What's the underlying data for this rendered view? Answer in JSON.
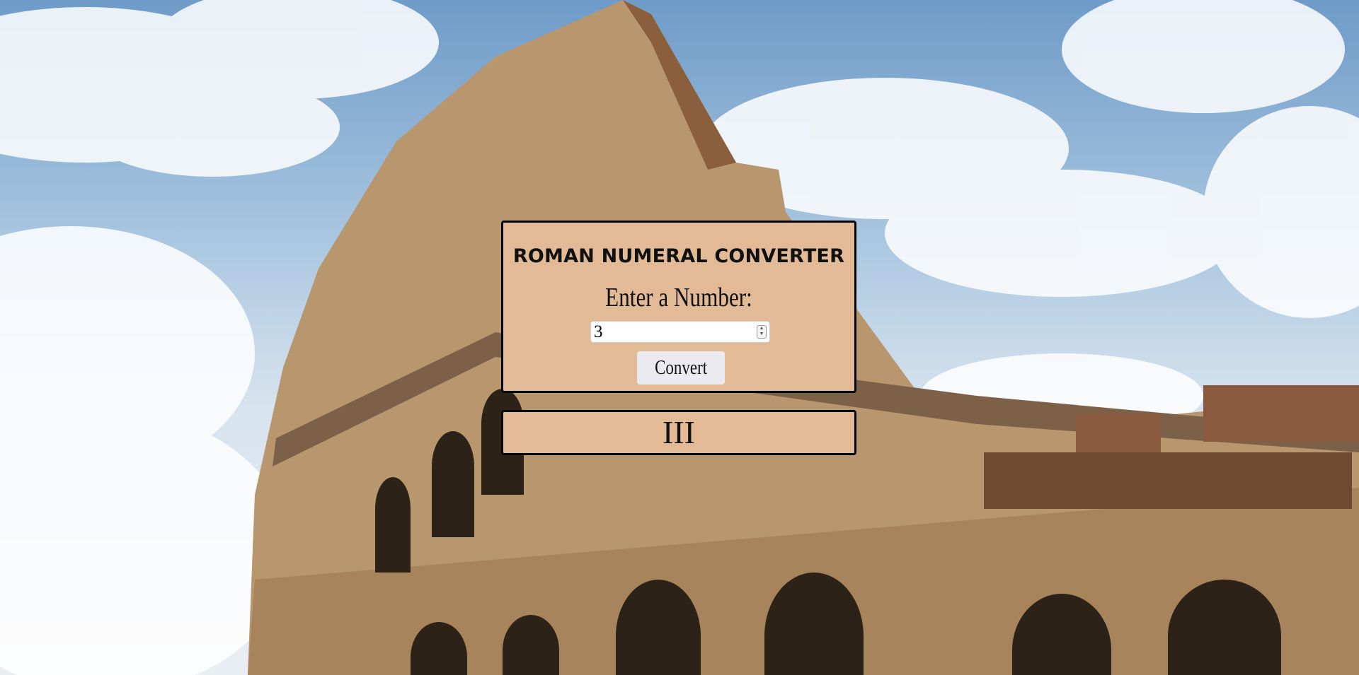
{
  "converter": {
    "title": "ROMAN NUMERAL CONVERTER",
    "label": "Enter a Number:",
    "input_value": "3",
    "button_label": "Convert",
    "spinner_icon": "spinner-arrows-icon"
  },
  "output": {
    "result": "III"
  },
  "colors": {
    "panel_background": "#e2bb96",
    "panel_border": "#000000",
    "button_background": "#ebebef"
  }
}
